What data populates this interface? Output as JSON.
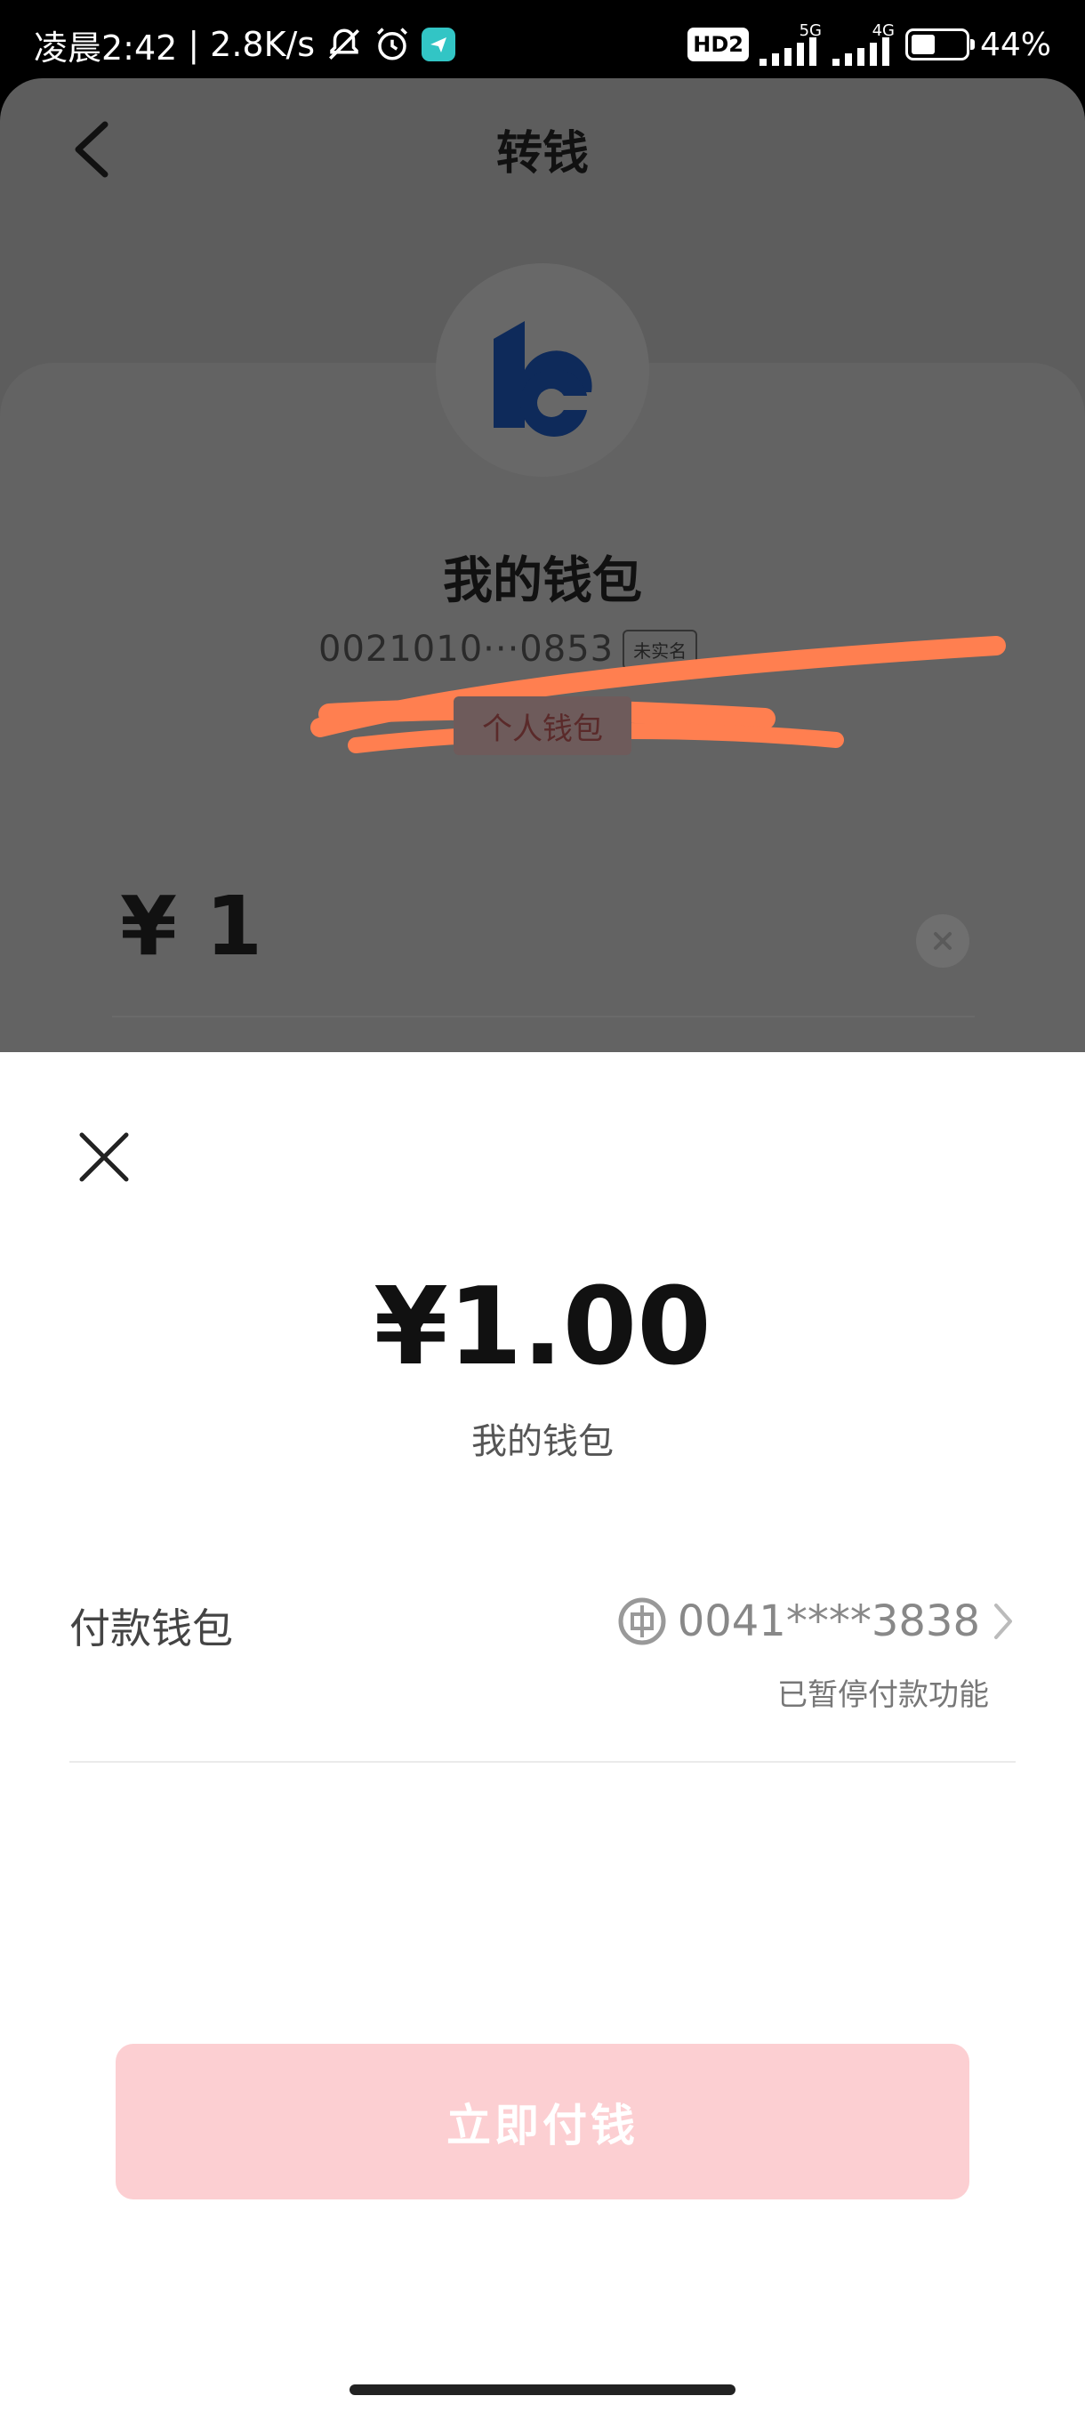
{
  "status_bar": {
    "time": "凌晨2:42",
    "speed": "2.8K/s",
    "network_badge": "HD2",
    "signal_1_label": "5G",
    "signal_2_label": "4G",
    "battery_level": 0.44,
    "battery_text": "44%"
  },
  "background_page": {
    "title": "转钱",
    "wallet_name": "我的钱包",
    "wallet_id": "0021010···0853",
    "unverified_label": "未实名",
    "personal_tag": "个人钱包",
    "amount_input": "¥ 1",
    "scribble_color": "#ff7f50"
  },
  "sheet": {
    "amount": "¥1.00",
    "subtitle": "我的钱包",
    "pay_wallet_label": "付款钱包",
    "pay_account": "0041****3838",
    "pay_account_note": "已暂停付款功能",
    "pay_button": "立即付钱"
  },
  "icons": {
    "back": "chevron-left-icon",
    "close": "close-icon",
    "clear": "clear-icon",
    "bank": "bank-icon",
    "chevron": "chevron-right-icon"
  },
  "colors": {
    "pay_button_bg": "#fccfd2",
    "logo_blue": "#0e2a5a"
  }
}
